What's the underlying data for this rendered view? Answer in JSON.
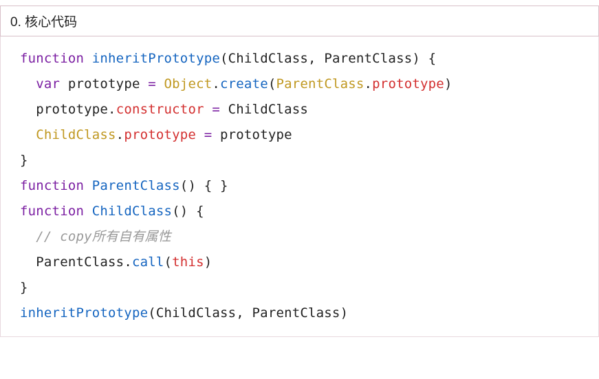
{
  "header": {
    "title": "0. 核心代码"
  },
  "code": {
    "l1": {
      "kw": "function",
      "fn": "inheritPrototype",
      "lp": "(",
      "p1": "ChildClass",
      "c": ", ",
      "p2": "ParentClass",
      "rp": ")",
      "sp": " ",
      "lb": "{"
    },
    "l2": {
      "ind": "  ",
      "kw": "var",
      "sp1": " ",
      "v": "prototype",
      "sp2": " ",
      "eq": "=",
      "sp3": " ",
      "obj": "Object",
      "d1": ".",
      "m": "create",
      "lp": "(",
      "arg": "ParentClass",
      "d2": ".",
      "prop": "prototype",
      "rp": ")"
    },
    "l3": {
      "ind": "  ",
      "v": "prototype",
      "d": ".",
      "prop": "constructor",
      "sp1": " ",
      "eq": "=",
      "sp2": " ",
      "rhs": "ChildClass"
    },
    "l4": {
      "ind": "  ",
      "v": "ChildClass",
      "d": ".",
      "prop": "prototype",
      "sp1": " ",
      "eq": "=",
      "sp2": " ",
      "rhs": "prototype"
    },
    "l5": {
      "rb": "}"
    },
    "l6": {
      "kw": "function",
      "sp": " ",
      "fn": "ParentClass",
      "lp": "(",
      "rp": ")",
      "sp2": " ",
      "lb": "{",
      "sp3": " ",
      "rb": "}"
    },
    "l7": {
      "kw": "function",
      "sp": " ",
      "fn": "ChildClass",
      "lp": "(",
      "rp": ")",
      "sp2": " ",
      "lb": "{"
    },
    "l8": {
      "ind": "  ",
      "c": "// copy所有自有属性"
    },
    "l9": {
      "ind": "  ",
      "v": "ParentClass",
      "d": ".",
      "m": "call",
      "lp": "(",
      "arg": "this",
      "rp": ")"
    },
    "l10": {
      "rb": "}"
    },
    "l11": {
      "fn": "inheritPrototype",
      "lp": "(",
      "a1": "ChildClass",
      "c": ", ",
      "a2": "ParentClass",
      "rp": ")"
    }
  }
}
